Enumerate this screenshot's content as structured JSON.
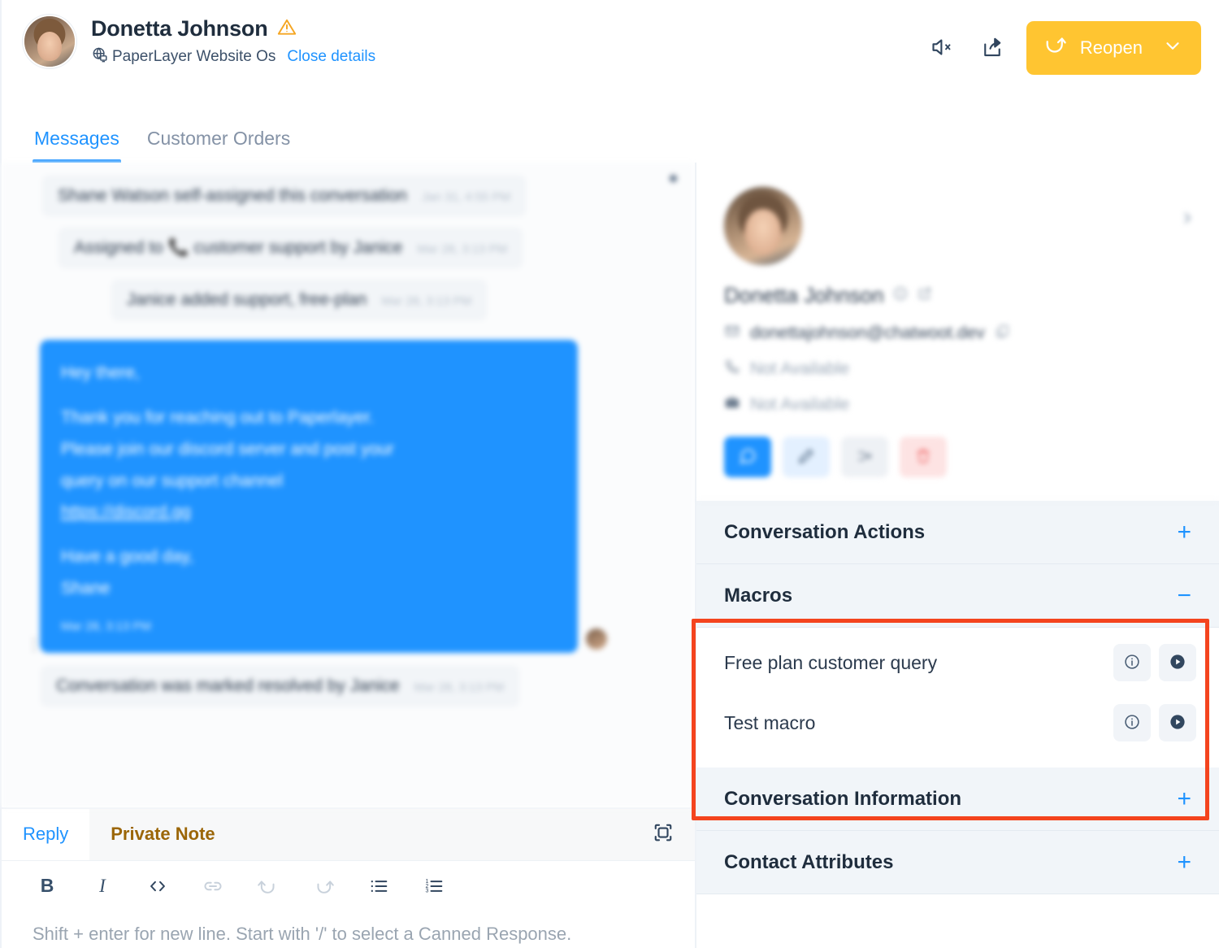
{
  "header": {
    "contact_name": "Donetta Johnson",
    "warning_icon": "warning-triangle-icon",
    "inbox_icon": "globe-desktop-icon",
    "inbox_name": "PaperLayer Website Os",
    "close_details_label": "Close details",
    "mute_icon": "speaker-mute-icon",
    "share_icon": "share-export-icon",
    "reopen_label": "Reopen",
    "reopen_icon": "reopen-arrow-icon",
    "reopen_chevron": "chevron-down-icon",
    "reopen_color": "#FFC531"
  },
  "tabs": [
    {
      "label": "Messages",
      "active": true
    },
    {
      "label": "Customer Orders",
      "active": false
    }
  ],
  "conversation": {
    "activities": [
      {
        "text": "Shane Watson self-assigned this conversation",
        "timestamp": "Jan 31, 4:55 PM"
      },
      {
        "text": "Assigned to 📞 customer support by Janice",
        "timestamp": "Mar 28, 3:13 PM"
      },
      {
        "text": "Janice added support, free-plan",
        "timestamp": "Mar 28, 3:13 PM"
      }
    ],
    "message": {
      "greeting": "Hey there,",
      "body_1": "Thank you for reaching out to Paperlayer.",
      "body_2": "Please join our discord server and post your",
      "body_3": "query on our support channel",
      "link": "https://discord.gg",
      "closing_1": "Have a good day,",
      "closing_2": "Shane",
      "timestamp": "Mar 28, 3:13 PM",
      "bubble_color": "#1f93ff"
    },
    "resolved_activity": {
      "text": "Conversation was marked resolved by Janice",
      "timestamp": "Mar 28, 3:13 PM"
    }
  },
  "reply_box": {
    "tabs": [
      {
        "label": "Reply",
        "active": true
      },
      {
        "label": "Private Note",
        "active": false
      }
    ],
    "expand_icon": "expand-fullscreen-icon",
    "format_buttons": [
      {
        "name": "bold-button",
        "glyph": "B"
      },
      {
        "name": "italic-button",
        "glyph": "I"
      },
      {
        "name": "code-button",
        "glyph": "</>"
      },
      {
        "name": "link-button",
        "glyph": "link"
      },
      {
        "name": "undo-button",
        "glyph": "undo"
      },
      {
        "name": "redo-button",
        "glyph": "redo"
      },
      {
        "name": "bullet-list-button",
        "glyph": "bullets"
      },
      {
        "name": "numbered-list-button",
        "glyph": "numbers"
      }
    ],
    "placeholder": "Shift + enter for new line. Start with '/' to select a Canned Response."
  },
  "sidebar": {
    "contact": {
      "name": "Donetta Johnson",
      "name_icons": [
        "info-circle-icon",
        "external-link-icon"
      ],
      "email": "donettajohnson@chatwoot.dev",
      "email_icon": "mail-icon",
      "copy_icon": "copy-icon",
      "phone": "Not Available",
      "phone_icon": "phone-icon",
      "company": "Not Available",
      "company_icon": "briefcase-icon",
      "collapse_icon": "chevron-right-icon",
      "actions": [
        {
          "name": "chat-action",
          "icon": "chat-bubble-icon",
          "style": "primary"
        },
        {
          "name": "edit-action",
          "icon": "pencil-icon",
          "style": "edit"
        },
        {
          "name": "merge-action",
          "icon": "merge-icon",
          "style": "merge"
        },
        {
          "name": "delete-action",
          "icon": "trash-icon",
          "style": "delete"
        }
      ]
    },
    "sections": [
      {
        "title": "Conversation Actions",
        "sign": "+",
        "expanded": false
      },
      {
        "title": "Macros",
        "sign": "−",
        "expanded": true
      },
      {
        "title": "Conversation Information",
        "sign": "+",
        "expanded": false
      },
      {
        "title": "Contact Attributes",
        "sign": "+",
        "expanded": false
      }
    ],
    "macros": [
      {
        "name": "Free plan customer query",
        "info_icon": "info-circle-icon",
        "run_icon": "play-circle-icon"
      },
      {
        "name": "Test macro",
        "info_icon": "info-circle-icon",
        "run_icon": "play-circle-icon"
      }
    ]
  },
  "annotation": {
    "highlight_color": "#F4441E",
    "highlight_target": "macros-section"
  }
}
